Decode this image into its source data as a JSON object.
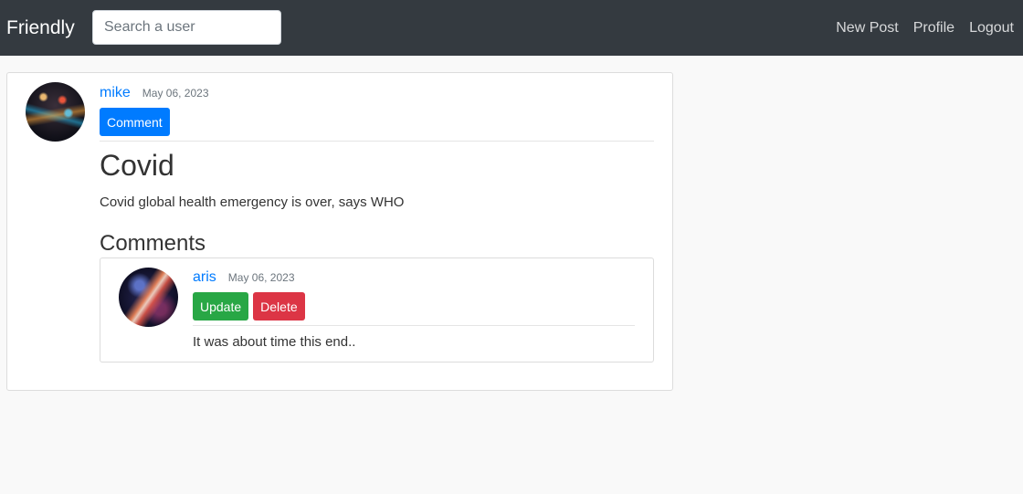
{
  "navbar": {
    "brand": "Friendly",
    "search_placeholder": "Search a user",
    "links": [
      "New Post",
      "Profile",
      "Logout"
    ]
  },
  "post": {
    "author": "mike",
    "date": "May 06, 2023",
    "comment_button": "Comment",
    "title": "Covid",
    "text": "Covid global health emergency is over, says WHO",
    "comments_heading": "Comments",
    "comments": [
      {
        "author": "aris",
        "date": "May 06, 2023",
        "update_button": "Update",
        "delete_button": "Delete",
        "text": "It was about time this end.."
      }
    ]
  },
  "colors": {
    "navbar_bg": "#343a40",
    "primary": "#007bff",
    "success": "#28a745",
    "danger": "#dc3545",
    "page_bg": "#f9f9f9"
  }
}
